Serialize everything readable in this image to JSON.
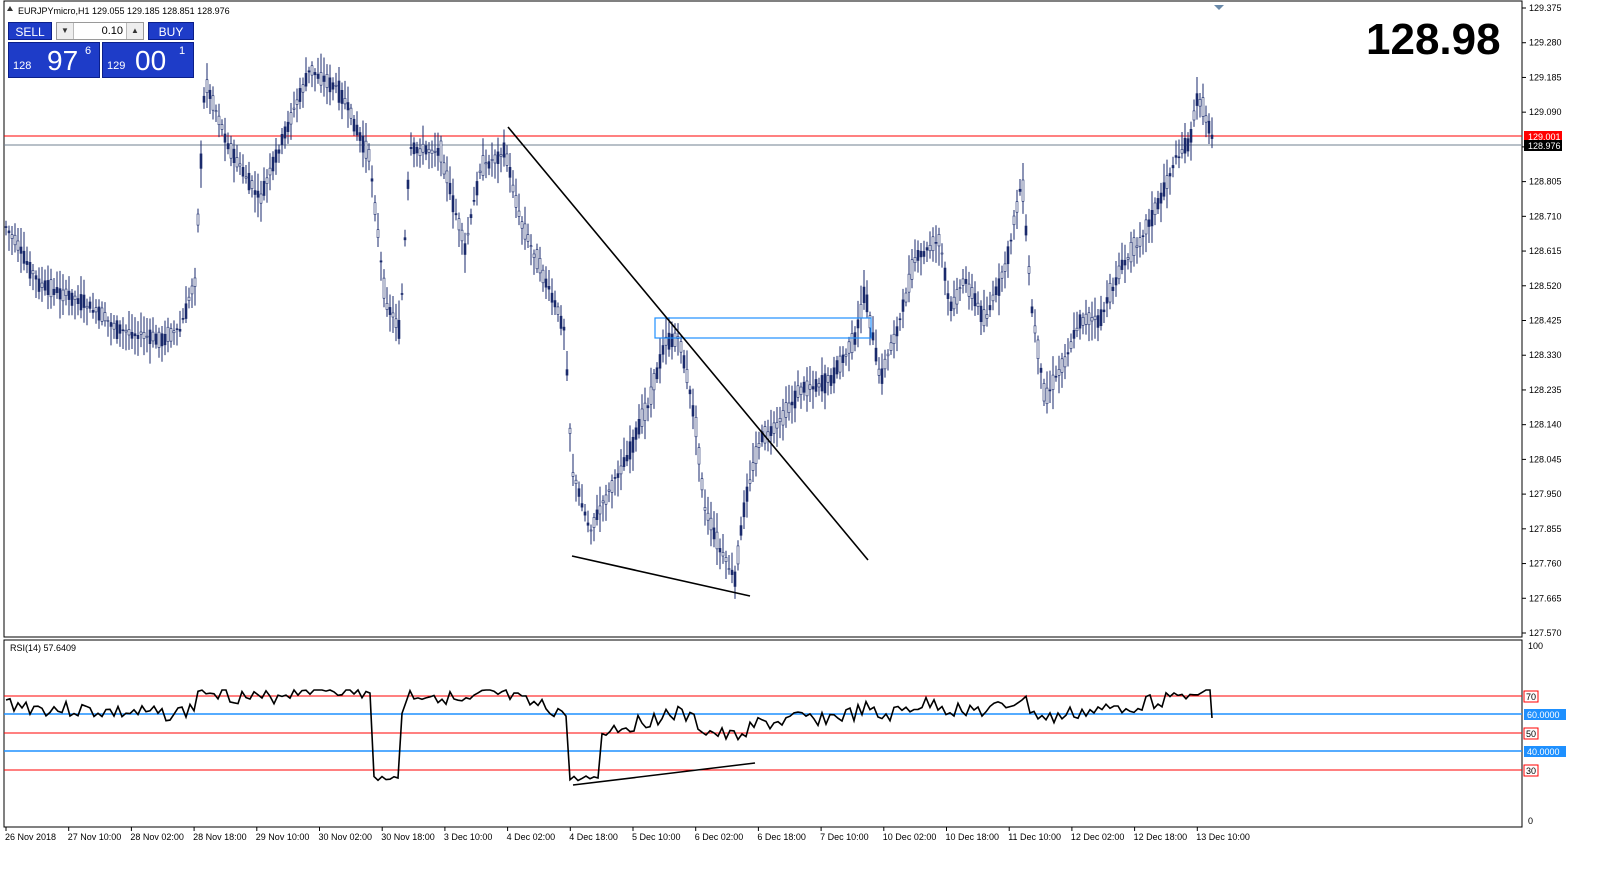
{
  "chart": {
    "title": "EURJPYmicro,H1  129.055 129.185 128.851 128.976",
    "big_price": "128.98",
    "price_levels": [
      "129.375",
      "129.280",
      "129.185",
      "129.090",
      "129.001",
      "128.976",
      "128.900",
      "128.805",
      "128.710",
      "128.615",
      "128.520",
      "128.425",
      "128.330",
      "128.235",
      "128.140",
      "128.045",
      "127.950",
      "127.855",
      "127.760",
      "127.665",
      "127.570"
    ],
    "time_labels": [
      "26 Nov 2018",
      "27 Nov 10:00",
      "28 Nov 02:00",
      "28 Nov 18:00",
      "29 Nov 10:00",
      "30 Nov 02:00",
      "30 Nov 18:00",
      "3 Dec 10:00",
      "4 Dec 02:00",
      "4 Dec 18:00",
      "5 Dec 10:00",
      "6 Dec 02:00",
      "6 Dec 18:00",
      "7 Dec 10:00",
      "10 Dec 02:00",
      "10 Dec 18:00",
      "11 Dec 10:00",
      "12 Dec 02:00",
      "12 Dec 18:00",
      "13 Dec 10:00"
    ],
    "ask_line_label": "129.001",
    "bid_line_label": "128.976",
    "colors": {
      "ask_line": "#ff0000",
      "bid_line": "#708090",
      "candle": "#1a2a6c",
      "zone": "#1e90ff",
      "trend": "#000000"
    }
  },
  "trade_panel": {
    "sell_label": "SELL",
    "buy_label": "BUY",
    "lot_value": "0.10",
    "bid_small": "128",
    "bid_large": "97",
    "bid_sup": "6",
    "ask_small": "129",
    "ask_large": "00",
    "ask_sup": "1"
  },
  "rsi": {
    "title": "RSI(14) 57.6409",
    "levels": [
      "100",
      "70",
      "60.0000",
      "50",
      "40.0000",
      "30",
      "0"
    ],
    "colors": {
      "level_red": "#ff0000",
      "level_blue": "#1e90ff",
      "line": "#000000"
    }
  }
}
